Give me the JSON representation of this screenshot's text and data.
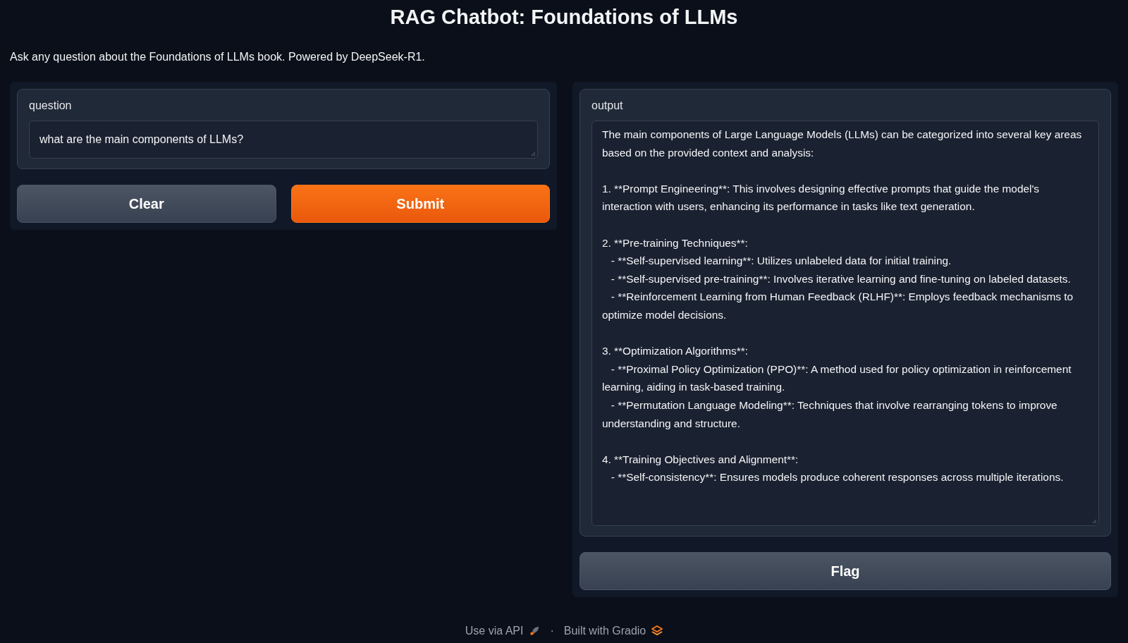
{
  "title": "RAG Chatbot: Foundations of LLMs",
  "description": "Ask any question about the Foundations of LLMs book. Powered by DeepSeek-R1.",
  "input_panel": {
    "label": "question",
    "value": "what are the main components of LLMs?",
    "buttons": [
      {
        "label": "Clear",
        "kind": "secondary"
      },
      {
        "label": "Submit",
        "kind": "primary"
      }
    ]
  },
  "output_panel": {
    "label": "output",
    "value": "The main components of Large Language Models (LLMs) can be categorized into several key areas based on the provided context and analysis:\n\n1. **Prompt Engineering**: This involves designing effective prompts that guide the model's interaction with users, enhancing its performance in tasks like text generation.\n\n2. **Pre-training Techniques**:\n   - **Self-supervised learning**: Utilizes unlabeled data for initial training.\n   - **Self-supervised pre-training**: Involves iterative learning and fine-tuning on labeled datasets.\n   - **Reinforcement Learning from Human Feedback (RLHF)**: Employs feedback mechanisms to optimize model decisions.\n\n3. **Optimization Algorithms**:\n   - **Proximal Policy Optimization (PPO)**: A method used for policy optimization in reinforcement learning, aiding in task-based training.\n   - **Permutation Language Modeling**: Techniques that involve rearranging tokens to improve understanding and structure.\n\n4. **Training Objectives and Alignment**:\n   - **Self-consistency**: Ensures models produce coherent responses across multiple iterations.",
    "buttons": [
      {
        "label": "Flag",
        "kind": "secondary"
      }
    ]
  },
  "footer": {
    "api_link": "Use via API",
    "separator": "·",
    "built_with": "Built with Gradio"
  }
}
